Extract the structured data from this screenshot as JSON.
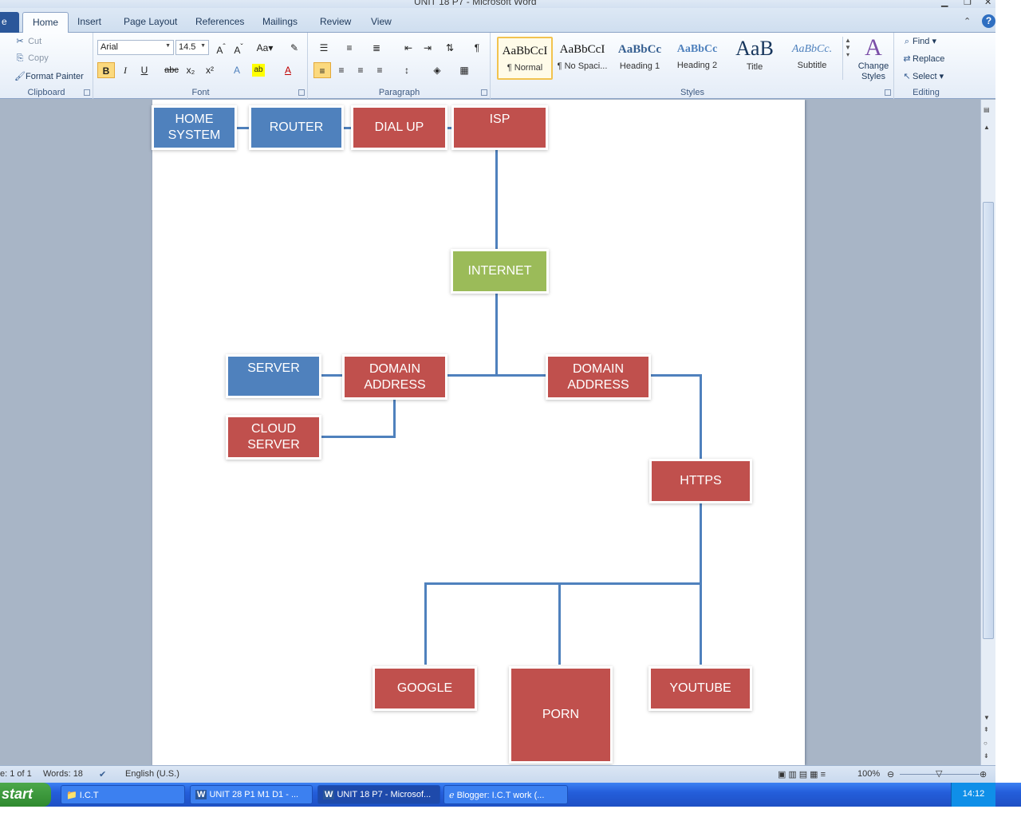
{
  "window": {
    "title": "UNIT 18 P7 - Microsoft Word"
  },
  "ribbon": {
    "file_tab": "e",
    "tabs": [
      "Home",
      "Insert",
      "Page Layout",
      "References",
      "Mailings",
      "Review",
      "View"
    ],
    "clipboard": {
      "cut": "Cut",
      "copy": "Copy",
      "format_painter": "Format Painter",
      "label": "Clipboard"
    },
    "font": {
      "name": "Arial",
      "size": "14.5",
      "label": "Font"
    },
    "paragraph": {
      "label": "Paragraph"
    },
    "styles": {
      "label": "Styles",
      "items": [
        {
          "sample": "AaBbCcI",
          "name": "¶ Normal"
        },
        {
          "sample": "AaBbCcI",
          "name": "¶ No Spaci..."
        },
        {
          "sample": "AaBbCc",
          "name": "Heading 1"
        },
        {
          "sample": "AaBbCc",
          "name": "Heading 2"
        },
        {
          "sample": "AaB",
          "name": "Title"
        },
        {
          "sample": "AaBbCc.",
          "name": "Subtitle"
        }
      ],
      "change_styles": "Change Styles"
    },
    "editing": {
      "find": "Find",
      "replace": "Replace",
      "select": "Select",
      "label": "Editing"
    }
  },
  "diagram": {
    "nodes": {
      "home_system": "HOME SYSTEM",
      "router": "ROUTER",
      "dial_up": "DIAL UP",
      "isp": "ISP",
      "internet": "INTERNET",
      "server": "SERVER",
      "domain_address_left": "DOMAIN ADDRESS",
      "domain_address_right": "DOMAIN ADDRESS",
      "cloud_server": "CLOUD SERVER",
      "https": "HTTPS",
      "google": "GOOGLE",
      "porn": "PORN",
      "youtube": "YOUTUBE"
    },
    "colors": {
      "red": "#c0504d",
      "blue": "#4f81bd",
      "green": "#9bbb59",
      "connector": "#4f81bd"
    }
  },
  "statusbar": {
    "page": "e: 1 of 1",
    "words": "Words: 18",
    "language": "English (U.S.)",
    "zoom": "100%"
  },
  "taskbar": {
    "start": "start",
    "tasks": [
      "I.C.T",
      "UNIT 28 P1 M1 D1 - ...",
      "UNIT 18 P7 - Microsof...",
      "Blogger: I.C.T work (..."
    ],
    "clock": "14:12"
  }
}
